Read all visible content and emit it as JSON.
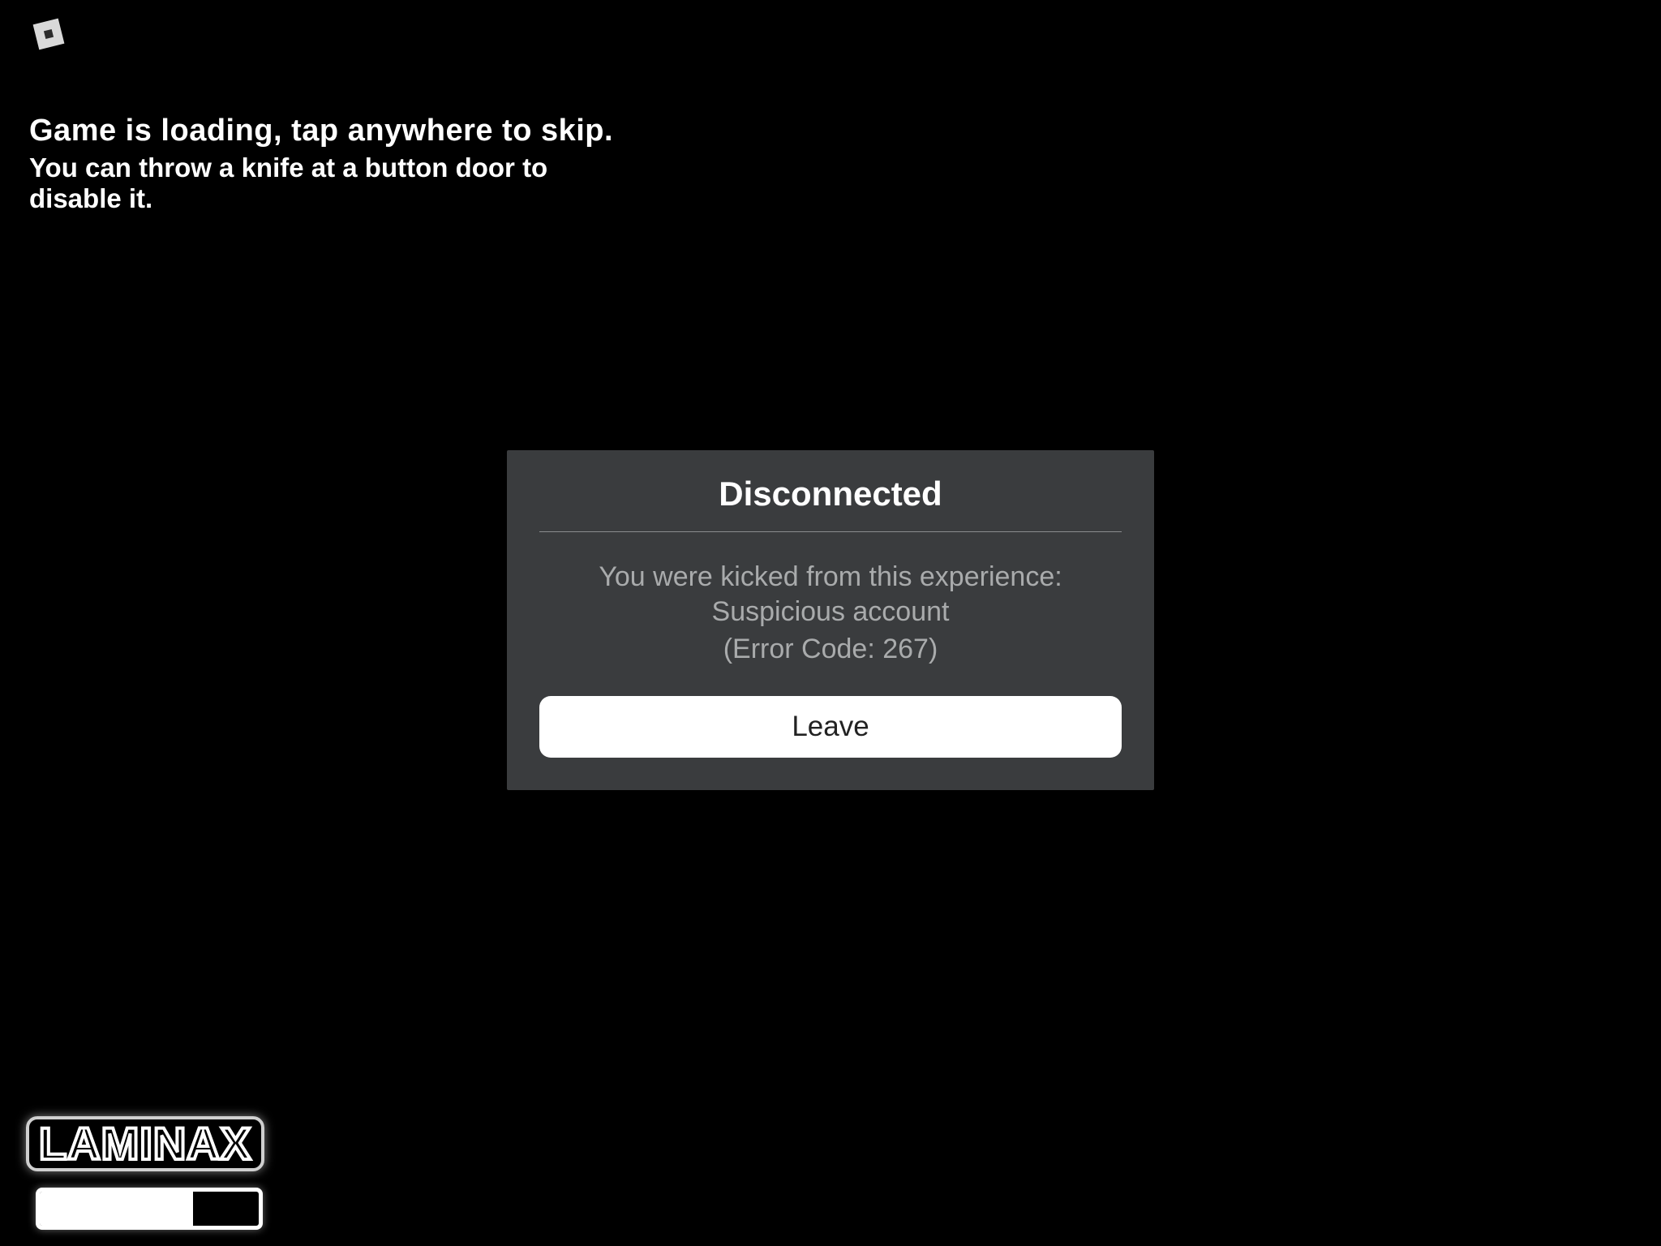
{
  "platform_icon": "roblox-logo",
  "loading": {
    "headline": "Game is loading, tap anywhere to skip.",
    "tip": "You can throw a knife at a button door to disable it."
  },
  "modal": {
    "title": "Disconnected",
    "message": "You were kicked from this experience: Suspicious account",
    "error_code": "(Error Code: 267)",
    "button_label": "Leave"
  },
  "game": {
    "name": "LAMINAX",
    "progress_percent": 70
  }
}
